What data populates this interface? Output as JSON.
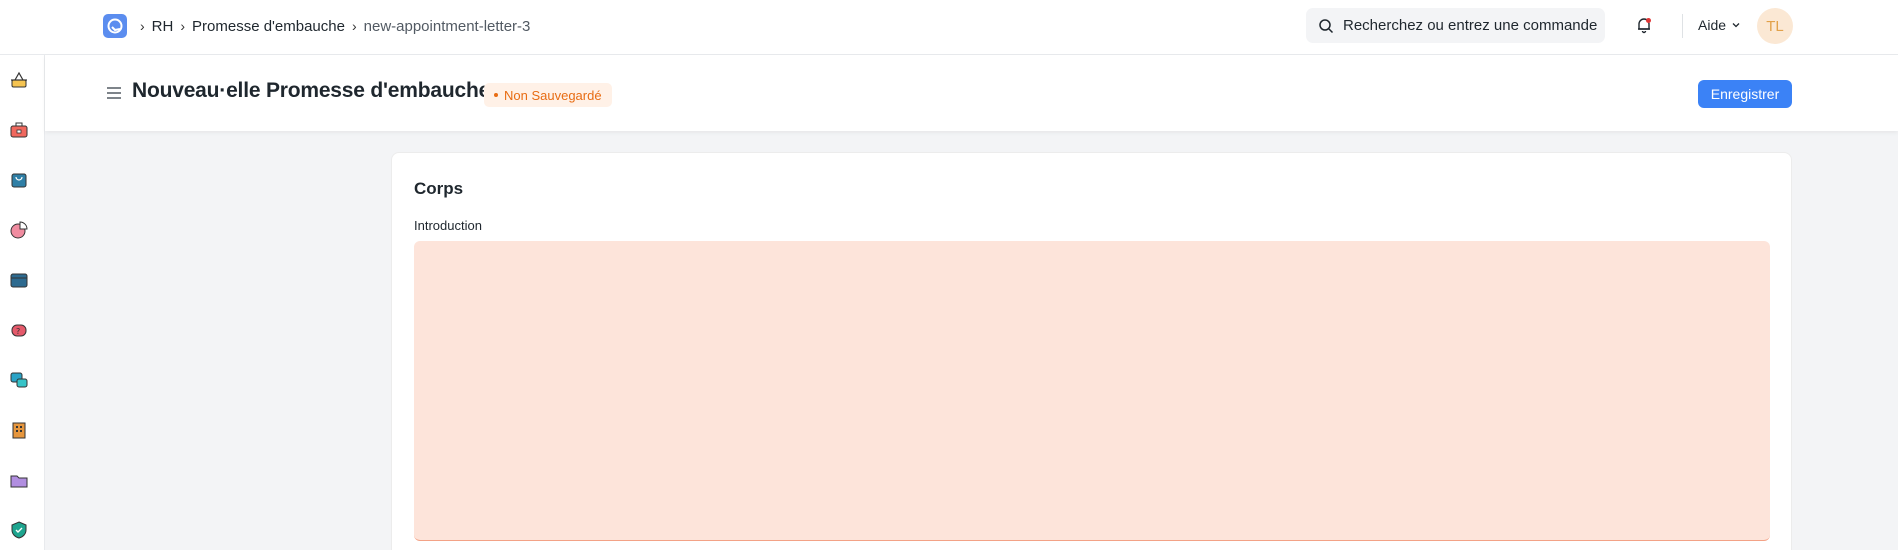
{
  "navbar": {
    "breadcrumbs": [
      "RH",
      "Promesse d'embauche",
      "new-appointment-letter-3"
    ],
    "search_placeholder": "Recherchez ou entrez une commande",
    "help_label": "Aide",
    "avatar_initials": "TL"
  },
  "sidebar": {
    "icons": [
      "basket-icon",
      "toolbox-icon",
      "shopping-bag-icon",
      "pie-chart-icon",
      "wallet-icon",
      "headset-icon",
      "chat-icon",
      "building-icon",
      "folder-icon",
      "shield-icon"
    ]
  },
  "page": {
    "title": "Nouveau·elle Promesse d'embauche",
    "status": "Non Sauvegardé",
    "save_label": "Enregistrer"
  },
  "form": {
    "section_title": "Corps",
    "introduction_label": "Introduction",
    "introduction_value": ""
  },
  "colors": {
    "primary": "#3b82f6",
    "unsaved": "#e86c13",
    "field_error_bg": "#fde4da"
  }
}
